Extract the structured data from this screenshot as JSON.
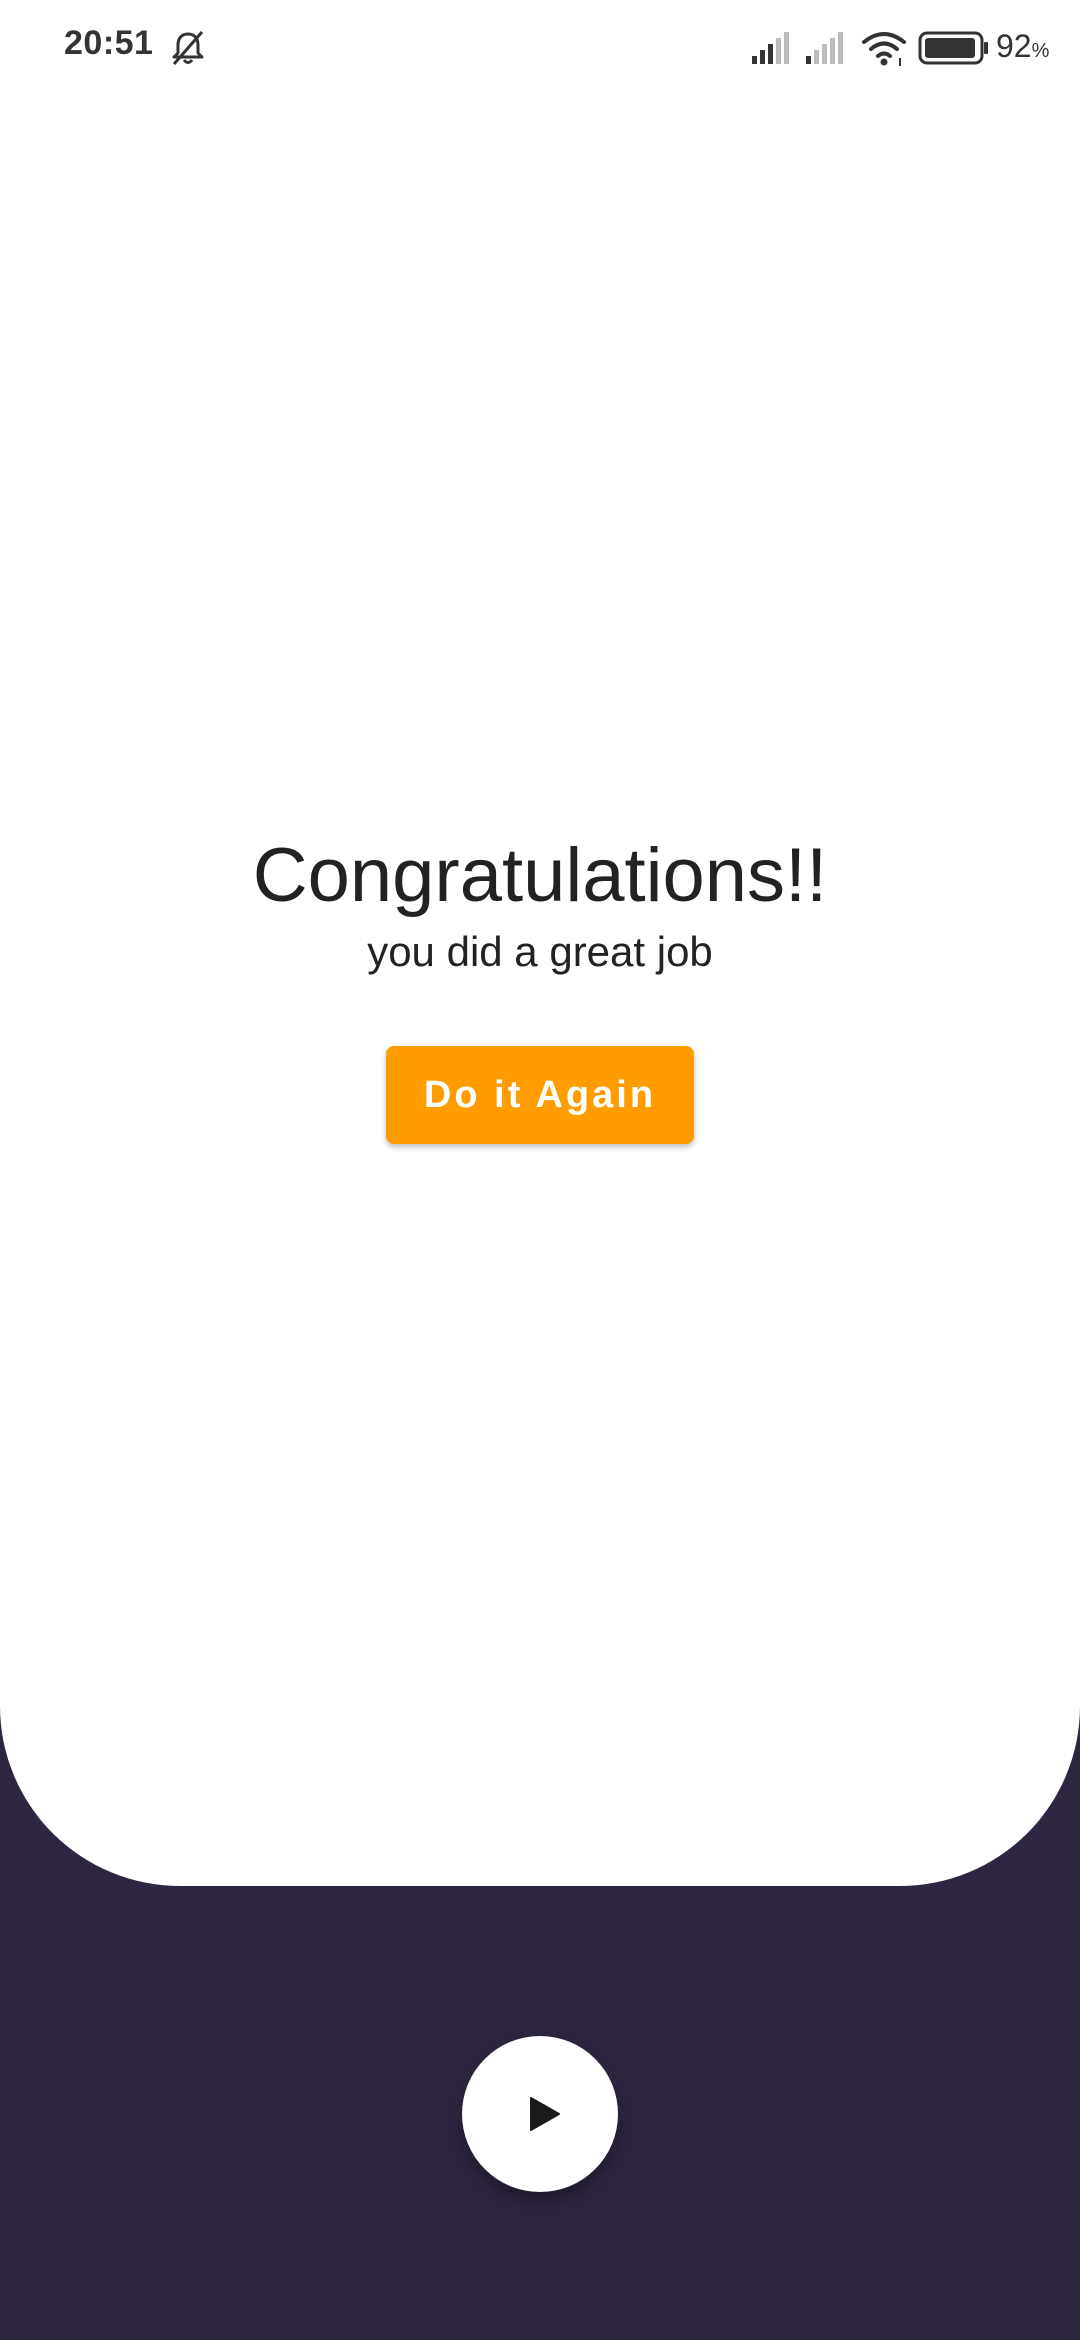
{
  "status_bar": {
    "time": "20:51",
    "battery_value": "92",
    "battery_unit": "%",
    "icons": [
      "mute-icon",
      "signal-icon",
      "signal-icon",
      "wifi-icon",
      "battery-icon"
    ]
  },
  "content": {
    "title": "Congratulations!!",
    "subtitle": "you did a great job",
    "button_label": "Do it Again"
  },
  "footer": {
    "play_icon": "play-icon"
  },
  "colors": {
    "background_dark": "#2e2640",
    "card": "#ffffff",
    "accent": "#ff9d00",
    "text": "#222222"
  }
}
